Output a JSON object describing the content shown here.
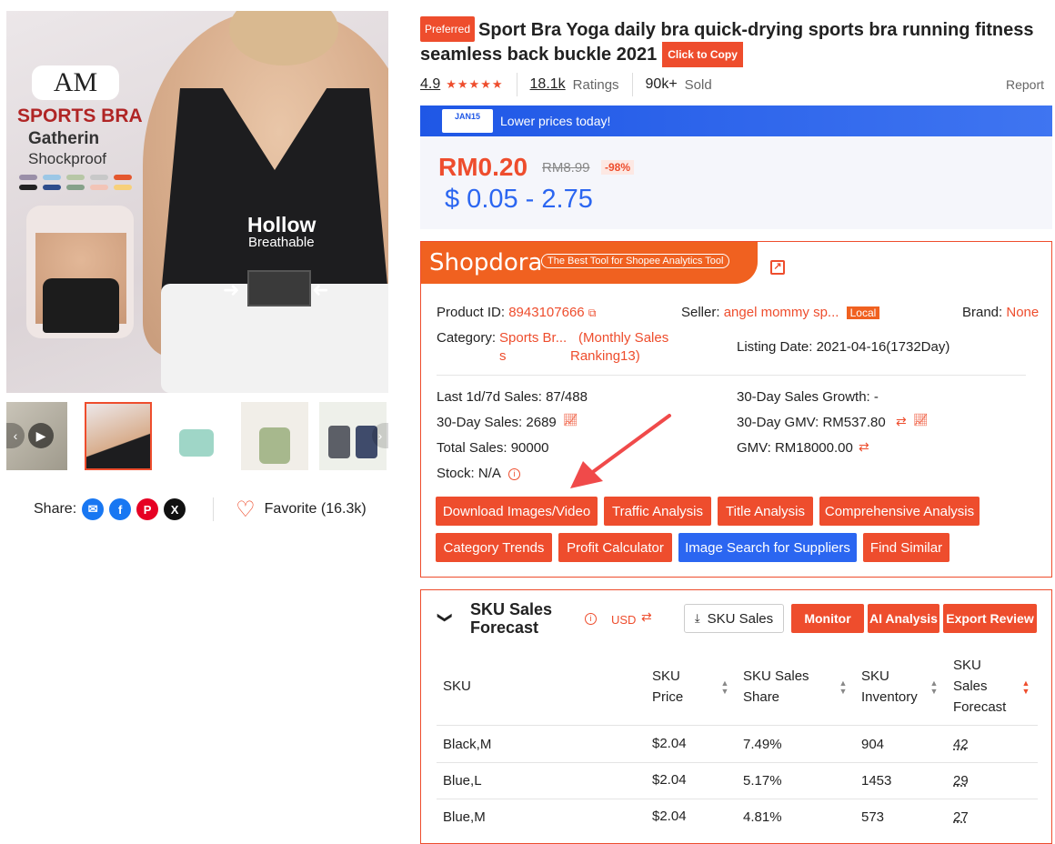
{
  "product": {
    "badge": "Preferred",
    "title": "Sport Bra Yoga daily bra quick-drying sports bra running fitness seamless back buckle 2021",
    "copy_label": "Click to Copy",
    "rating": "4.9",
    "ratings_count": "18.1k",
    "ratings_label": "Ratings",
    "sold_count": "90k+",
    "sold_label": "Sold",
    "report_label": "Report"
  },
  "image_text": {
    "logo": "AM",
    "line1": "SPORTS BRA",
    "line2": "Gatherin",
    "line3": "Shockproof",
    "hollow": "Hollow",
    "breathable": "Breathable"
  },
  "banner": {
    "badge_top": "JAN15",
    "text": "Lower prices today!"
  },
  "price": {
    "current": "RM0.20",
    "original": "RM8.99",
    "discount": "-98%",
    "usd_range": "$ 0.05 - 2.75"
  },
  "share": {
    "label": "Share:",
    "favorite_label": "Favorite (16.3k)"
  },
  "shopdora": {
    "brand": "Shopdora",
    "tagline": "The Best Tool for Shopee Analytics Tool",
    "product_id_label": "Product ID:",
    "product_id": "8943107666",
    "seller_label": "Seller:",
    "seller": "angel mommy sp...",
    "seller_tag": "Local",
    "brand_label": "Brand:",
    "brand_value": "None",
    "category_label": "Category:",
    "category_line1": "Sports Br...",
    "category_line2": "s",
    "ranking_line1": "(Monthly Sales",
    "ranking_line2": "Ranking13)",
    "listing_date_label": "Listing Date:",
    "listing_date": "2021-04-16(1732Day)",
    "sales_1d7d": "Last 1d/7d Sales: 87/488",
    "growth_30d": "30-Day Sales Growth: -",
    "sales_30d": "30-Day Sales: 2689",
    "gmv_30d": "30-Day GMV: RM537.80",
    "total_sales": "Total Sales: 90000",
    "gmv": "GMV: RM18000.00",
    "stock": "Stock: N/A",
    "buttons_row1": [
      "Download Images/Video",
      "Traffic Analysis",
      "Title Analysis",
      "Comprehensive Analysis"
    ],
    "buttons_row2": [
      "Category Trends",
      "Profit Calculator",
      "Image Search for Suppliers",
      "Find Similar"
    ]
  },
  "sku": {
    "title_line1": "SKU Sales",
    "title_line2": "Forecast",
    "currency": "USD",
    "sku_sales_btn": "SKU Sales",
    "monitor_btn": "Monitor",
    "ai_btn": "AI Analysis",
    "export_btn": "Export Review",
    "headers": {
      "sku": "SKU",
      "price1": "SKU",
      "price2": "Price",
      "share1": "SKU Sales",
      "share2": "Share",
      "inv1": "SKU",
      "inv2": "Inventory",
      "fc1": "SKU",
      "fc2": "Sales",
      "fc3": "Forecast"
    },
    "rows": [
      {
        "sku": "Black,M",
        "price": "$2.04",
        "share": "7.49%",
        "inventory": "904",
        "forecast": "42"
      },
      {
        "sku": "Blue,L",
        "price": "$2.04",
        "share": "5.17%",
        "inventory": "1453",
        "forecast": "29"
      },
      {
        "sku": "Blue,M",
        "price": "$2.04",
        "share": "4.81%",
        "inventory": "573",
        "forecast": "27"
      }
    ]
  }
}
